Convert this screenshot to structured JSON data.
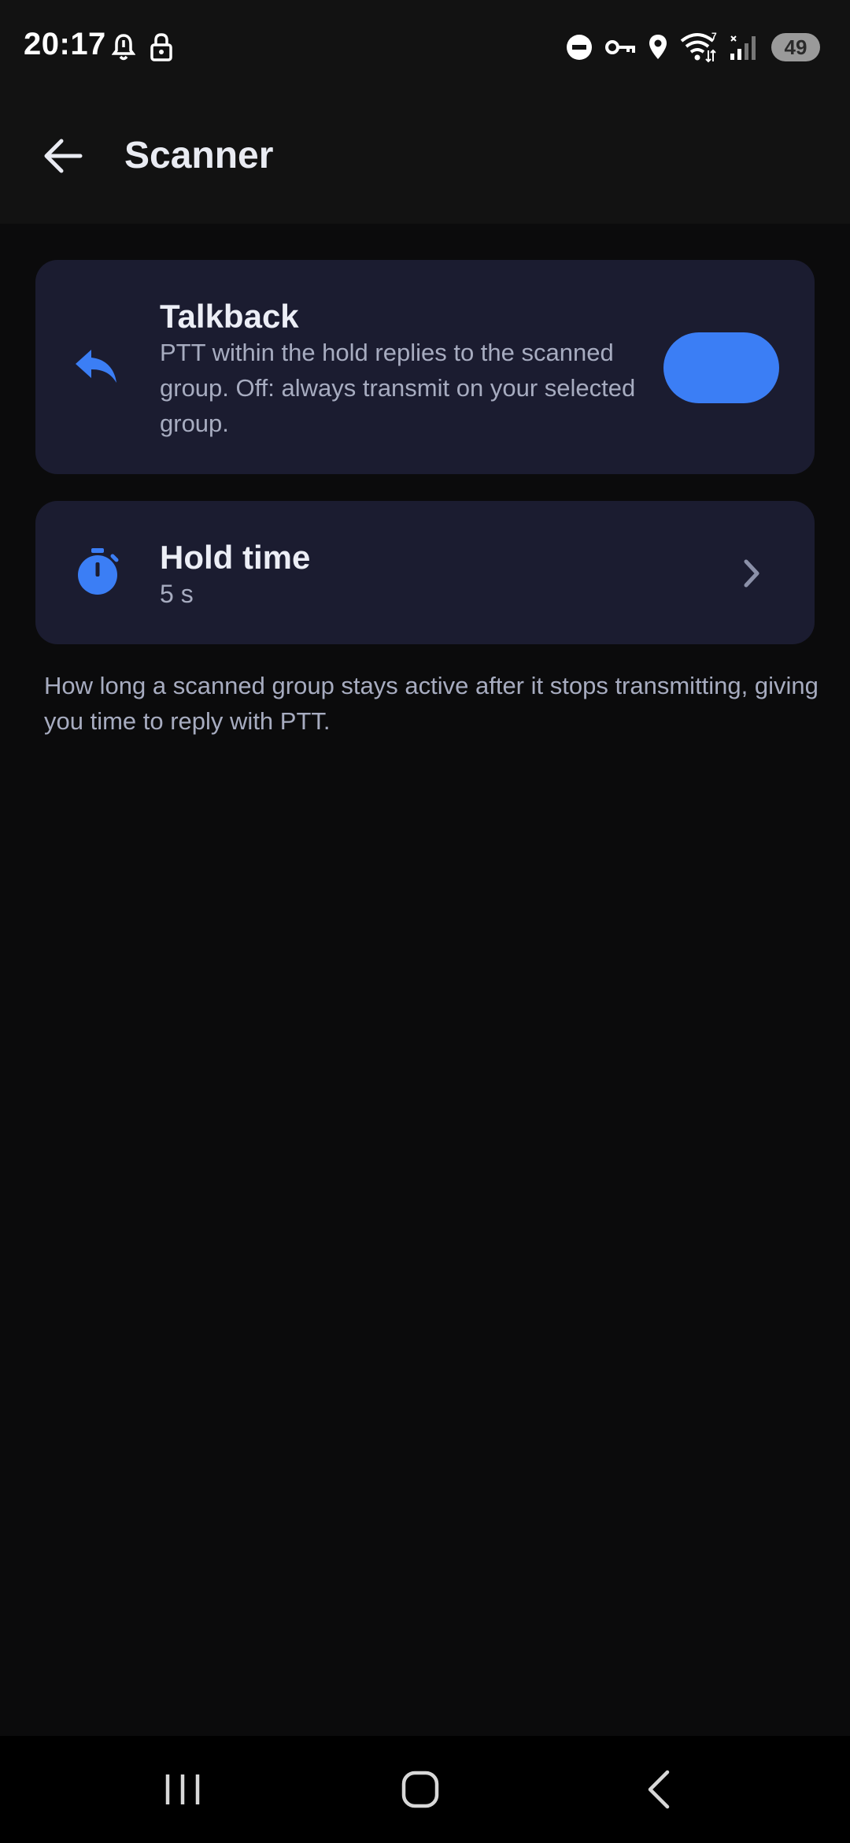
{
  "status_bar": {
    "time": "20:17",
    "left_icons": [
      "alarm-icon",
      "lock-icon"
    ],
    "right_icons": [
      "do-not-disturb-icon",
      "vpn-key-icon",
      "location-icon",
      "wifi-icon",
      "signal-icon"
    ],
    "battery_level": "49"
  },
  "header": {
    "title": "Scanner",
    "back_icon": "arrow-back-icon"
  },
  "settings": {
    "talkback": {
      "icon": "reply-icon",
      "title": "Talkback",
      "description": "PTT within the hold replies to the scanned group. Off: always transmit on your selected group.",
      "enabled": true
    },
    "hold_time": {
      "icon": "timer-icon",
      "title": "Hold time",
      "value": "5 s",
      "chevron_icon": "chevron-right-icon"
    },
    "helper_text": "How long a scanned group stays active after it stops transmitting, giving you time to reply with PTT."
  },
  "nav_bar": {
    "buttons": [
      "recents-icon",
      "home-icon",
      "back-icon"
    ]
  },
  "colors": {
    "accent": "#3b7ef5",
    "card_background": "#1b1c30",
    "background": "#0b0b0c"
  }
}
